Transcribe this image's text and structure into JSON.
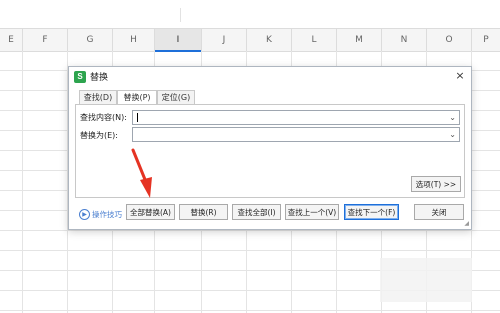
{
  "spreadsheet": {
    "columns": [
      "E",
      "F",
      "G",
      "H",
      "I",
      "J",
      "K",
      "L",
      "M",
      "N",
      "O",
      "P"
    ],
    "active_column": "I"
  },
  "dialog": {
    "title": "替换",
    "close_symbol": "×",
    "tabs": [
      {
        "label": "查找(D)",
        "selected": false
      },
      {
        "label": "替换(P)",
        "selected": true
      },
      {
        "label": "定位(G)",
        "selected": false
      }
    ],
    "find_label": "查找内容(N):",
    "find_value": "",
    "replace_label": "替换为(E):",
    "replace_value": "",
    "options_button": "选项(T) >>",
    "tips_label": "操作技巧",
    "buttons": {
      "replace_all": "全部替换(A)",
      "replace": "替换(R)",
      "find_all": "查找全部(I)",
      "find_prev": "查找上一个(V)",
      "find_next": "查找下一个(F)",
      "close": "关闭"
    }
  },
  "colors": {
    "annotation_arrow": "#e53323",
    "accent_blue": "#1e6fd9",
    "icon_green": "#2da44e"
  }
}
